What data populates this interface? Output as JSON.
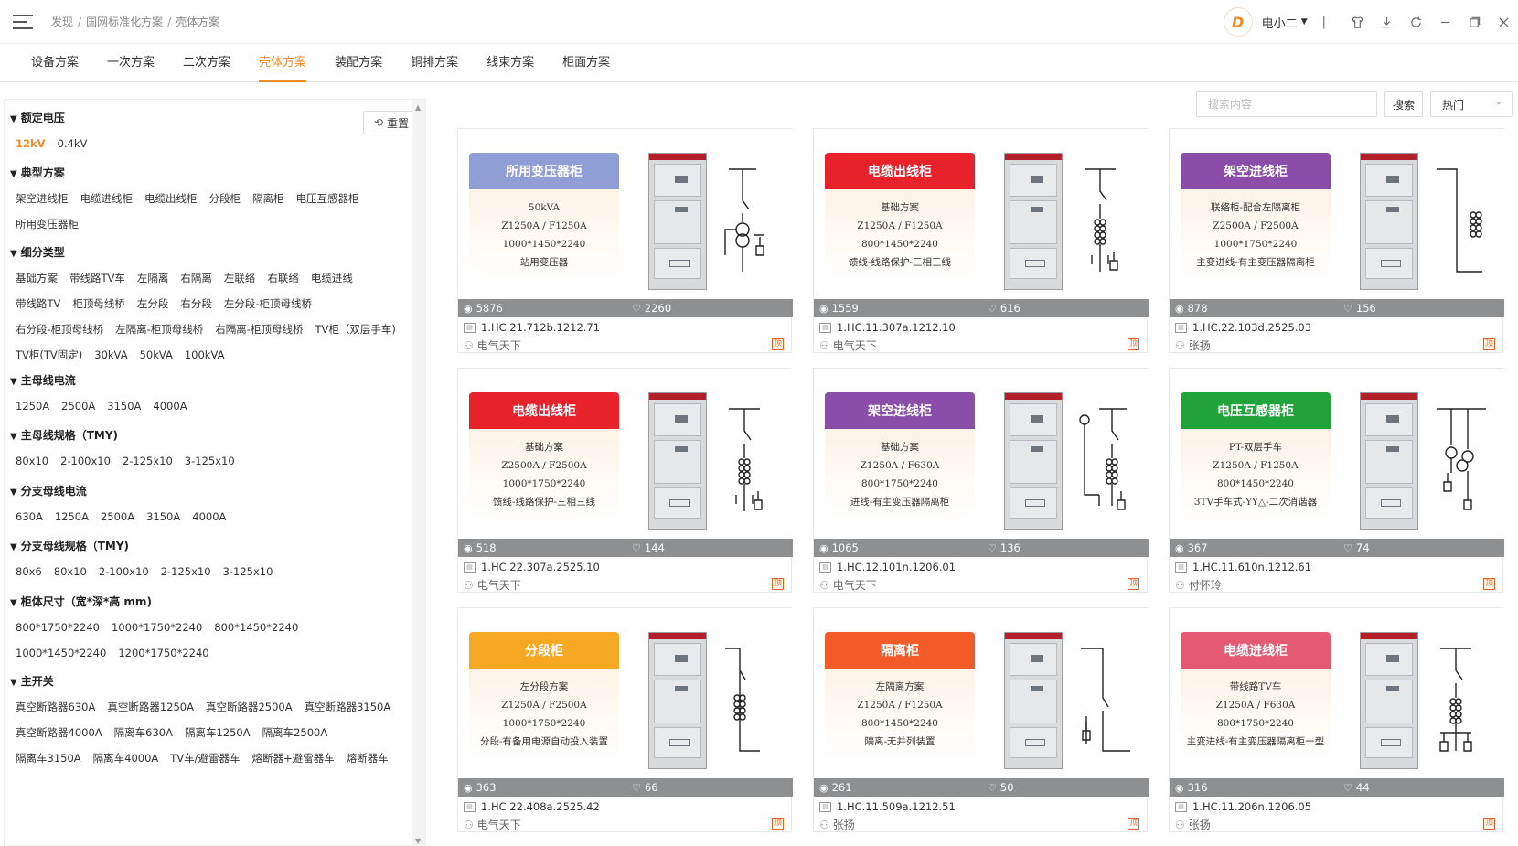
{
  "breadcrumb": [
    "发现",
    "国网标准化方案",
    "壳体方案"
  ],
  "breadcrumb_sep": "/",
  "user": {
    "name": "电小二",
    "logo_letter": "D"
  },
  "tabs": [
    {
      "label": "设备方案"
    },
    {
      "label": "一次方案"
    },
    {
      "label": "二次方案"
    },
    {
      "label": "壳体方案",
      "active": true
    },
    {
      "label": "装配方案"
    },
    {
      "label": "铜排方案"
    },
    {
      "label": "线束方案"
    },
    {
      "label": "柜面方案"
    }
  ],
  "search": {
    "placeholder": "搜索内容",
    "button": "搜索",
    "sort": "热门"
  },
  "sidebar": {
    "reset": "重置",
    "groups": [
      {
        "title": "额定电压",
        "options": [
          "12kV",
          "0.4kV"
        ],
        "selected": 0
      },
      {
        "title": "典型方案",
        "options": [
          "架空进线柜",
          "电缆进线柜",
          "电缆出线柜",
          "分段柜",
          "隔离柜",
          "电压互感器柜",
          "所用变压器柜"
        ]
      },
      {
        "title": "细分类型",
        "options": [
          "基础方案",
          "带线路TV车",
          "左隔离",
          "右隔离",
          "左联络",
          "右联络",
          "电缆进线",
          "带线路TV",
          "柜顶母线桥",
          "左分段",
          "右分段",
          "左分段-柜顶母线桥",
          "右分段-柜顶母线桥",
          "左隔离-柜顶母线桥",
          "右隔离-柜顶母线桥",
          "TV柜（双层手车)",
          "TV柜(TV固定)",
          "30kVA",
          "50kVA",
          "100kVA"
        ]
      },
      {
        "title": "主母线电流",
        "options": [
          "1250A",
          "2500A",
          "3150A",
          "4000A"
        ]
      },
      {
        "title": "主母线规格（TMY)",
        "options": [
          "80x10",
          "2-100x10",
          "2-125x10",
          "3-125x10"
        ]
      },
      {
        "title": "分支母线电流",
        "options": [
          "630A",
          "1250A",
          "2500A",
          "3150A",
          "4000A"
        ]
      },
      {
        "title": "分支母线规格（TMY)",
        "options": [
          "80x6",
          "80x10",
          "2-100x10",
          "2-125x10",
          "3-125x10"
        ]
      },
      {
        "title": "柜体尺寸（宽*深*高 mm)",
        "options": [
          "800*1750*2240",
          "1000*1750*2240",
          "800*1450*2240",
          "1000*1450*2240",
          "1200*1750*2240"
        ]
      },
      {
        "title": "主开关",
        "options": [
          "真空断路器630A",
          "真空断路器1250A",
          "真空断路器2500A",
          "真空断路器3150A",
          "真空断路器4000A",
          "隔离车630A",
          "隔离车1250A",
          "隔离车2500A",
          "隔离车3150A",
          "隔离车4000A",
          "TV车/避雷器车",
          "熔断器+避雷器车",
          "熔断器车"
        ]
      }
    ]
  },
  "top_badge_label": "顶",
  "cards": [
    {
      "title": "所用变压器柜",
      "color": "#8f9fd6",
      "specs": [
        "50kVA",
        "Z1250A / F1250A",
        "1000*1450*2240",
        "站用变压器"
      ],
      "views": "5876",
      "likes": "2260",
      "code": "1.HC.21.712b.1212.71",
      "author": "电气天下",
      "diagram": "transformer"
    },
    {
      "title": "电缆出线柜",
      "color": "#e8222b",
      "specs": [
        "基础方案",
        "Z1250A / F1250A",
        "800*1450*2240",
        "馈线-线路保护-三相三线"
      ],
      "views": "1559",
      "likes": "616",
      "code": "1.HC.11.307a.1212.10",
      "author": "电气天下",
      "diagram": "cable"
    },
    {
      "title": "架空进线柜",
      "color": "#8a4ea8",
      "specs": [
        "联络柜-配合左隔离柜",
        "Z2500A / F2500A",
        "1000*1750*2240",
        "主变进线-有主变压器隔离柜"
      ],
      "views": "878",
      "likes": "156",
      "code": "1.HC.22.103d.2525.03",
      "author": "张扬",
      "diagram": "overhead"
    },
    {
      "title": "电缆出线柜",
      "color": "#e8222b",
      "specs": [
        "基础方案",
        "Z2500A / F2500A",
        "1000*1750*2240",
        "馈线-线路保护-三相三线"
      ],
      "views": "518",
      "likes": "144",
      "code": "1.HC.22.307a.2525.10",
      "author": "电气天下",
      "diagram": "cable"
    },
    {
      "title": "架空进线柜",
      "color": "#8a4ea8",
      "specs": [
        "基础方案",
        "Z1250A / F630A",
        "800*1750*2240",
        "进线-有主变压器隔离柜"
      ],
      "views": "1065",
      "likes": "136",
      "code": "1.HC.12.101n.1206.01",
      "author": "电气天下",
      "diagram": "overhead2"
    },
    {
      "title": "电压互感器柜",
      "color": "#1fa33a",
      "specs": [
        "PT-双层手车",
        "Z1250A / F1250A",
        "800*1450*2240",
        "3TV手车式-YY△-二次消谐器"
      ],
      "views": "367",
      "likes": "74",
      "code": "1.HC.11.610n.1212.61",
      "author": "付怀玲",
      "diagram": "pt"
    },
    {
      "title": "分段柜",
      "color": "#f7a823",
      "specs": [
        "左分段方案",
        "Z1250A / F2500A",
        "1000*1750*2240",
        "分段-有备用电源自动投入装置"
      ],
      "views": "363",
      "likes": "66",
      "code": "1.HC.22.408a.2525.42",
      "author": "电气天下",
      "diagram": "section"
    },
    {
      "title": "隔离柜",
      "color": "#f25a28",
      "specs": [
        "左隔离方案",
        "Z1250A / F1250A",
        "800*1450*2240",
        "隔离-无并列装置"
      ],
      "views": "261",
      "likes": "50",
      "code": "1.HC.11.509a.1212.51",
      "author": "张扬",
      "diagram": "isolate"
    },
    {
      "title": "电缆进线柜",
      "color": "#e35a72",
      "specs": [
        "带线路TV车",
        "Z1250A / F630A",
        "800*1750*2240",
        "主变进线-有主变压器隔离柜一型"
      ],
      "views": "316",
      "likes": "44",
      "code": "1.HC.11.206n.1206.05",
      "author": "张扬",
      "diagram": "cablein"
    }
  ]
}
